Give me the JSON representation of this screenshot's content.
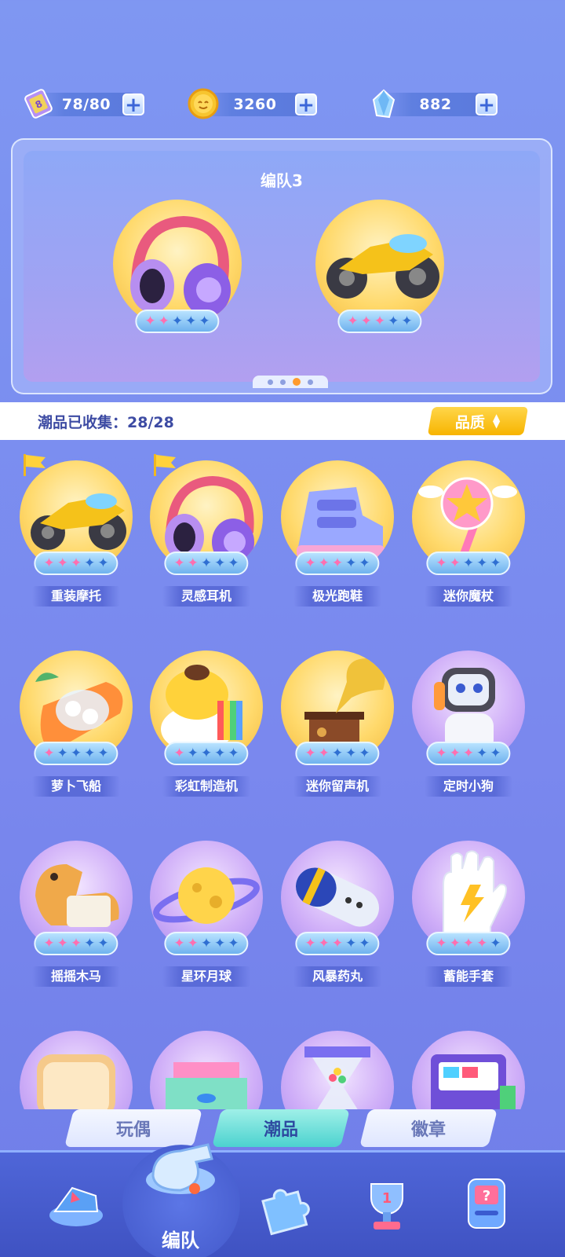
{
  "currencies": {
    "ticket": {
      "value": "78/80",
      "icon": "ticket-icon"
    },
    "coin": {
      "value": "3260",
      "icon": "coin-icon"
    },
    "gem": {
      "value": "882",
      "icon": "crystal-icon"
    }
  },
  "team": {
    "title": "编队3",
    "slots": [
      {
        "item": "headphones",
        "stars_filled": 2,
        "stars_total": 5
      },
      {
        "item": "motorbike",
        "stars_filled": 3,
        "stars_total": 5
      }
    ],
    "pages": 4,
    "active_page": 3
  },
  "collection": {
    "label": "潮品已收集：28/28",
    "quality_label": "品质"
  },
  "items": [
    {
      "name": "重装摩托",
      "stars": 3,
      "bg": "gold",
      "flag": true,
      "art": "motorbike"
    },
    {
      "name": "灵感耳机",
      "stars": 2,
      "bg": "gold",
      "flag": true,
      "art": "headphones"
    },
    {
      "name": "极光跑鞋",
      "stars": 3,
      "bg": "gold",
      "flag": false,
      "art": "shoe"
    },
    {
      "name": "迷你魔杖",
      "stars": 2,
      "bg": "gold",
      "flag": false,
      "art": "wand"
    },
    {
      "name": "萝卜飞船",
      "stars": 1,
      "bg": "gold",
      "flag": false,
      "art": "carrot"
    },
    {
      "name": "彩虹制造机",
      "stars": 1,
      "bg": "gold",
      "flag": false,
      "art": "rainbow"
    },
    {
      "name": "迷你留声机",
      "stars": 2,
      "bg": "gold",
      "flag": false,
      "art": "gramophone"
    },
    {
      "name": "定时小狗",
      "stars": 3,
      "bg": "purple",
      "flag": false,
      "art": "dog"
    },
    {
      "name": "摇摇木马",
      "stars": 3,
      "bg": "purple",
      "flag": false,
      "art": "horse"
    },
    {
      "name": "星环月球",
      "stars": 2,
      "bg": "purple",
      "flag": false,
      "art": "planet"
    },
    {
      "name": "风暴药丸",
      "stars": 3,
      "bg": "purple",
      "flag": false,
      "art": "pill"
    },
    {
      "name": "蓄能手套",
      "stars": 4,
      "bg": "purple",
      "flag": false,
      "art": "glove"
    },
    {
      "name": "",
      "stars": 0,
      "bg": "purple",
      "flag": false,
      "art": "toast"
    },
    {
      "name": "",
      "stars": 0,
      "bg": "purple",
      "flag": false,
      "art": "desk"
    },
    {
      "name": "",
      "stars": 0,
      "bg": "purple",
      "flag": false,
      "art": "hourglass"
    },
    {
      "name": "",
      "stars": 0,
      "bg": "purple",
      "flag": false,
      "art": "arcade"
    }
  ],
  "category_tabs": [
    {
      "label": "玩偶",
      "active": false
    },
    {
      "label": "潮品",
      "active": true
    },
    {
      "label": "徽章",
      "active": false
    }
  ],
  "bottom_nav": {
    "team_label": "编队",
    "items": [
      "shoe-arrow-icon",
      "whistle-icon",
      "puzzle-icon",
      "trophy-icon",
      "mystery-machine-icon"
    ]
  },
  "colors": {
    "accent": "#f7b400",
    "pink_star": "#ff6fb0",
    "blue_star": "#2f6fd2",
    "title": "#3d4ba3"
  }
}
